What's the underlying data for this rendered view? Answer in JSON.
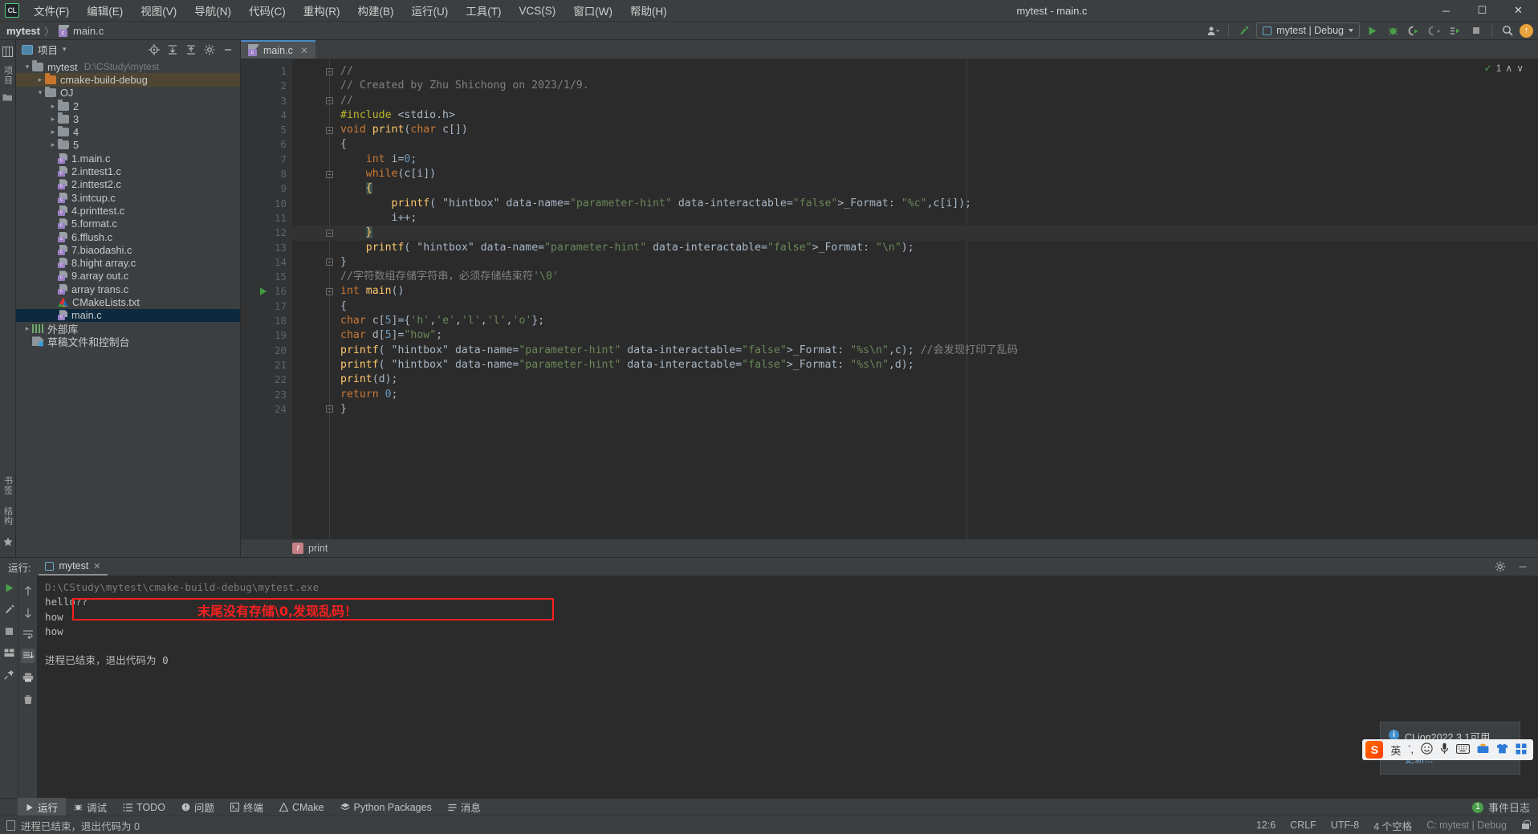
{
  "window": {
    "title": "mytest - main.c",
    "minimize": "─",
    "maximize": "☐",
    "close": "✕"
  },
  "logo": "CL",
  "menu": [
    {
      "label": "文件(F)",
      "name": "menu-file"
    },
    {
      "label": "编辑(E)",
      "name": "menu-edit"
    },
    {
      "label": "视图(V)",
      "name": "menu-view"
    },
    {
      "label": "导航(N)",
      "name": "menu-navigate"
    },
    {
      "label": "代码(C)",
      "name": "menu-code"
    },
    {
      "label": "重构(R)",
      "name": "menu-refactor"
    },
    {
      "label": "构建(B)",
      "name": "menu-build"
    },
    {
      "label": "运行(U)",
      "name": "menu-run"
    },
    {
      "label": "工具(T)",
      "name": "menu-tools"
    },
    {
      "label": "VCS(S)",
      "name": "menu-vcs"
    },
    {
      "label": "窗口(W)",
      "name": "menu-window"
    },
    {
      "label": "帮助(H)",
      "name": "menu-help"
    }
  ],
  "navbar": {
    "project": "mytest",
    "separator": "〉",
    "file": "main.c",
    "file_icon_letter": "c",
    "run_config": "mytest | Debug",
    "icons": {
      "settings_sync": "▾",
      "updates": "↑",
      "search": "⌕",
      "stop": "■"
    }
  },
  "left_rail": {
    "project_label": "项目",
    "structure_label": "结构",
    "bookmarks_label": "书签",
    "favorites_label": "收藏夹"
  },
  "project_panel": {
    "title": "项目",
    "dropdown_caret": "▾",
    "tools": [
      "locate-icon",
      "expand-all-icon",
      "collapse-all-icon",
      "settings-icon",
      "hide-icon"
    ],
    "tree": [
      {
        "label": "mytest",
        "path": "D:\\CStudy\\mytest",
        "indent": 0,
        "type": "folder",
        "arrow": "open",
        "state": "none"
      },
      {
        "label": "cmake-build-debug",
        "path": "",
        "indent": 1,
        "type": "folder-orange",
        "arrow": "closed",
        "state": "brown"
      },
      {
        "label": "OJ",
        "path": "",
        "indent": 1,
        "type": "folder",
        "arrow": "open",
        "state": "none"
      },
      {
        "label": "2",
        "path": "",
        "indent": 2,
        "type": "folder",
        "arrow": "closed",
        "state": "none"
      },
      {
        "label": "3",
        "path": "",
        "indent": 2,
        "type": "folder",
        "arrow": "closed",
        "state": "none"
      },
      {
        "label": "4",
        "path": "",
        "indent": 2,
        "type": "folder",
        "arrow": "closed",
        "state": "none"
      },
      {
        "label": "5",
        "path": "",
        "indent": 2,
        "type": "folder",
        "arrow": "closed",
        "state": "none"
      },
      {
        "label": "1.main.c",
        "path": "",
        "indent": 2,
        "type": "cfile",
        "arrow": "none",
        "state": "none"
      },
      {
        "label": "2.inttest1.c",
        "path": "",
        "indent": 2,
        "type": "cfile",
        "arrow": "none",
        "state": "none"
      },
      {
        "label": "2.inttest2.c",
        "path": "",
        "indent": 2,
        "type": "cfile",
        "arrow": "none",
        "state": "none"
      },
      {
        "label": "3.intcup.c",
        "path": "",
        "indent": 2,
        "type": "cfile",
        "arrow": "none",
        "state": "none"
      },
      {
        "label": "4.printtest.c",
        "path": "",
        "indent": 2,
        "type": "cfile",
        "arrow": "none",
        "state": "none"
      },
      {
        "label": "5.format.c",
        "path": "",
        "indent": 2,
        "type": "cfile",
        "arrow": "none",
        "state": "none"
      },
      {
        "label": "6.fflush.c",
        "path": "",
        "indent": 2,
        "type": "cfile",
        "arrow": "none",
        "state": "none"
      },
      {
        "label": "7.biaodashi.c",
        "path": "",
        "indent": 2,
        "type": "cfile",
        "arrow": "none",
        "state": "none"
      },
      {
        "label": "8.hight array.c",
        "path": "",
        "indent": 2,
        "type": "cfile",
        "arrow": "none",
        "state": "none"
      },
      {
        "label": "9.array out.c",
        "path": "",
        "indent": 2,
        "type": "cfile",
        "arrow": "none",
        "state": "none"
      },
      {
        "label": "array trans.c",
        "path": "",
        "indent": 2,
        "type": "cfile",
        "arrow": "none",
        "state": "none"
      },
      {
        "label": "CMakeLists.txt",
        "path": "",
        "indent": 2,
        "type": "cmake",
        "arrow": "none",
        "state": "none"
      },
      {
        "label": "main.c",
        "path": "",
        "indent": 2,
        "type": "cfile",
        "arrow": "none",
        "state": "blue"
      },
      {
        "label": "外部库",
        "path": "",
        "indent": 0,
        "type": "lib",
        "arrow": "closed",
        "state": "none"
      },
      {
        "label": "草稿文件和控制台",
        "path": "",
        "indent": 0,
        "type": "scratch",
        "arrow": "none",
        "state": "none"
      }
    ]
  },
  "editor": {
    "tab": {
      "label": "main.c",
      "close": "✕",
      "icon_letter": "c"
    },
    "inspection": {
      "count": "1",
      "check": "✓",
      "up": "∧",
      "down": "∨"
    },
    "breadcrumb": {
      "label": "print",
      "icon_letter": "f"
    },
    "lines": [
      {
        "n": 1,
        "fold": "minus"
      },
      {
        "n": 2,
        "fold": ""
      },
      {
        "n": 3,
        "fold": "end"
      },
      {
        "n": 4,
        "fold": ""
      },
      {
        "n": 5,
        "fold": "minus"
      },
      {
        "n": 6,
        "fold": ""
      },
      {
        "n": 7,
        "fold": ""
      },
      {
        "n": 8,
        "fold": "minus"
      },
      {
        "n": 9,
        "fold": ""
      },
      {
        "n": 10,
        "fold": ""
      },
      {
        "n": 11,
        "fold": ""
      },
      {
        "n": 12,
        "fold": "end"
      },
      {
        "n": 13,
        "fold": ""
      },
      {
        "n": 14,
        "fold": "end"
      },
      {
        "n": 15,
        "fold": ""
      },
      {
        "n": 16,
        "fold": "minus",
        "runmark": true
      },
      {
        "n": 17,
        "fold": ""
      },
      {
        "n": 18,
        "fold": ""
      },
      {
        "n": 19,
        "fold": ""
      },
      {
        "n": 20,
        "fold": ""
      },
      {
        "n": 21,
        "fold": ""
      },
      {
        "n": 22,
        "fold": ""
      },
      {
        "n": 23,
        "fold": ""
      },
      {
        "n": 24,
        "fold": "end"
      }
    ],
    "code_text": [
      "//",
      "// Created by Zhu Shichong on 2023/1/9.",
      "//",
      "#include <stdio.h>",
      "void print(char c[])",
      "{",
      "    int i=0;",
      "    while(c[i])",
      "    {",
      "        printf( _Format: \"%c\",c[i]);",
      "        i++;",
      "    }",
      "    printf( _Format: \"\\n\");",
      "}",
      "//字符数组存储字符串，必须存储结束符'\\0'",
      "int main()",
      "{",
      "char c[5]={'h','e','l','l','o'};",
      "char d[5]=\"how\";",
      "printf( _Format: \"%s\\n\",c); //会发现打印了乱码",
      "printf( _Format: \"%s\\n\",d);",
      "print(d);",
      "return 0;",
      "}"
    ]
  },
  "run_panel": {
    "label": "运行:",
    "tab": "mytest",
    "tab_close": "✕",
    "settings_icon": "gear-icon",
    "hide_icon": "─",
    "console_lines": [
      {
        "text": "D:\\CStudy\\mytest\\cmake-build-debug\\mytest.exe",
        "style": "path"
      },
      {
        "text": "hello??",
        "style": ""
      },
      {
        "text": "how",
        "style": ""
      },
      {
        "text": "how",
        "style": ""
      },
      {
        "text": "",
        "style": ""
      },
      {
        "text": "进程已结束，退出代码为 0",
        "style": ""
      }
    ],
    "annotation": "末尾没有存储\\0,发现乱码！",
    "annotation_color": "#fc1f1f",
    "rail_left": [
      "▶",
      "⚒",
      "■",
      "☷",
      "✒",
      "✕"
    ],
    "rail_right": [
      "↑",
      "↓",
      "↩",
      "↧",
      "⎙",
      "Ὕ1"
    ]
  },
  "notification": {
    "title": "CLion2022.3.1可用",
    "link": "更新...",
    "info_glyph": "i"
  },
  "ime": {
    "logo": "S",
    "mode": "英",
    "punct": "‵,",
    "emoji": "☺",
    "mic": "Ἲ4",
    "keyboard": "⌨",
    "toolbox": "὎6",
    "shirt": "ὅ5",
    "apps": "▦"
  },
  "bottom_toolbar": {
    "items": [
      {
        "label": "运行",
        "icon": "run-icon",
        "active": true
      },
      {
        "label": "调试",
        "icon": "debug-icon",
        "active": false
      },
      {
        "label": "TODO",
        "icon": "todo-icon",
        "active": false
      },
      {
        "label": "问题",
        "icon": "problems-icon",
        "active": false
      },
      {
        "label": "终端",
        "icon": "terminal-icon",
        "active": false
      },
      {
        "label": "CMake",
        "icon": "cmake-icon",
        "active": false
      },
      {
        "label": "Python Packages",
        "icon": "packages-icon",
        "active": false
      },
      {
        "label": "消息",
        "icon": "messages-icon",
        "active": false
      }
    ],
    "event_log": "事件日志",
    "event_count": "1"
  },
  "statusbar": {
    "message": "进程已结束，退出代码为 0",
    "caret": "12:6",
    "line_sep": "CRLF",
    "encoding": "UTF-8",
    "indent": "4 个空格",
    "branch": "C: mytest | Debug",
    "lock": "lock-icon"
  }
}
